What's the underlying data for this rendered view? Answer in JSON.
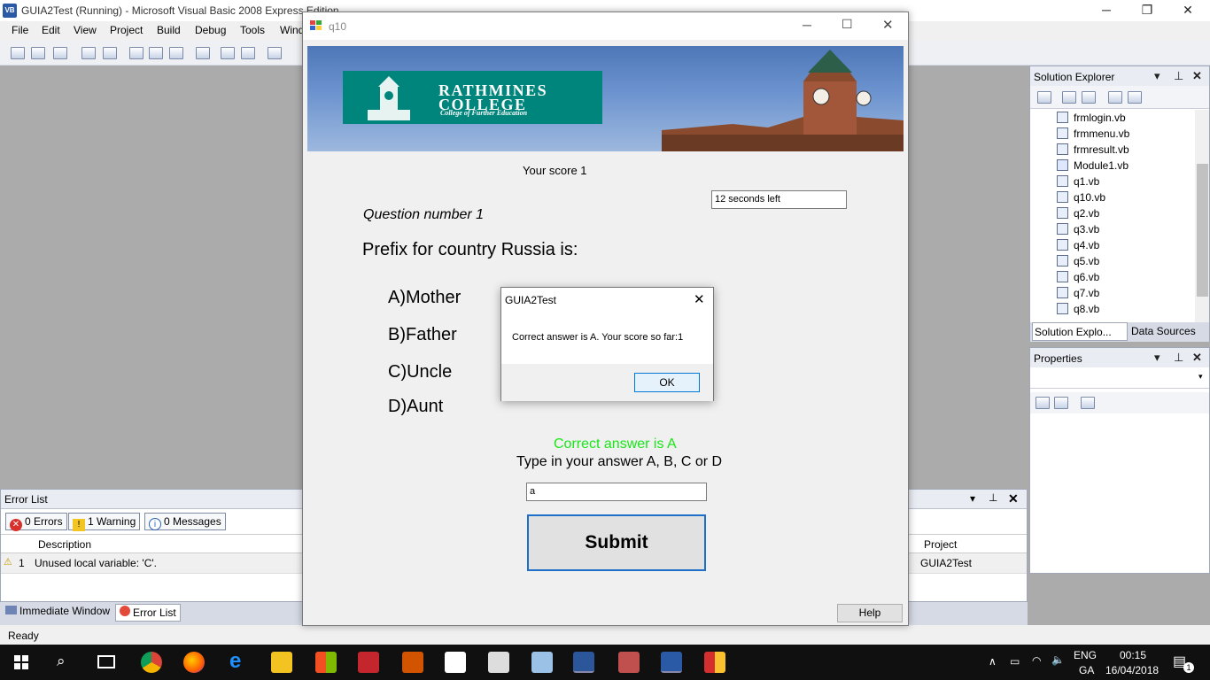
{
  "vs": {
    "title": "GUIA2Test (Running) - Microsoft Visual Basic 2008 Express Edition",
    "app_icon_text": "VB",
    "menu": [
      "File",
      "Edit",
      "View",
      "Project",
      "Build",
      "Debug",
      "Tools",
      "Wind"
    ],
    "status": "Ready"
  },
  "error_list": {
    "title": "Error List",
    "errors_btn": "0 Errors",
    "warnings_btn": "1 Warning",
    "messages_btn": "0 Messages",
    "col_description": "Description",
    "col_project": "Project",
    "row": {
      "index": "1",
      "description": "Unused local variable: 'C'.",
      "project": "GUIA2Test"
    }
  },
  "bottom_tabs": [
    "Immediate Window",
    "Error List"
  ],
  "solution_explorer": {
    "title": "Solution Explorer",
    "files": [
      "frmlogin.vb",
      "frmmenu.vb",
      "frmresult.vb",
      "Module1.vb",
      "q1.vb",
      "q10.vb",
      "q2.vb",
      "q3.vb",
      "q4.vb",
      "q5.vb",
      "q6.vb",
      "q7.vb",
      "q8.vb"
    ],
    "tab1": "Solution Explo...",
    "tab2": "Data Sources"
  },
  "properties": {
    "title": "Properties"
  },
  "form": {
    "title": "q10",
    "college_line1": "RATHMINES",
    "college_line2": "COLLEGE",
    "college_tagline": "College of Further Education",
    "score": "Your score 1",
    "timer": "12 seconds left",
    "question_number": "Question number 1",
    "question": "Prefix for country Russia is:",
    "answers": [
      "A)Mother",
      "B)Father",
      "C)Uncle",
      "D)Aunt"
    ],
    "feedback": "Correct answer is A",
    "feedback_color": "#19e619",
    "instruction": "Type in your answer A, B, C or D",
    "answer_value": "a",
    "submit": "Submit",
    "help": "Help"
  },
  "msgbox": {
    "title": "GUIA2Test",
    "message": "Correct answer is A. Your score so far:1",
    "ok": "OK"
  },
  "taskbar": {
    "lang1": "ENG",
    "lang2": "GA",
    "time": "00:15",
    "date": "16/04/2018",
    "notification_count": "1"
  }
}
